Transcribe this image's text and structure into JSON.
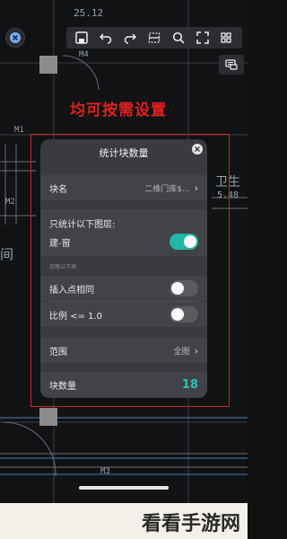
{
  "cad": {
    "dim_top": "25.12",
    "label_m4": "M4",
    "label_m1": "M1",
    "label_m2": "M2",
    "label_m3": "M3",
    "room_label": "卫生",
    "room_dim": "5.48",
    "left_char": "间"
  },
  "toolbar": {
    "icons": [
      "save-icon",
      "undo-icon",
      "redo-icon",
      "select-icon",
      "zoom-icon",
      "fullscreen-icon",
      "more-icon"
    ]
  },
  "annotation": "均可按需设置",
  "dialog": {
    "title": "统计块数量",
    "block_name_label": "块名",
    "block_name_value": "二维门库$...",
    "layer_only_label": "只统计以下图层:",
    "layer_name": "建-窗",
    "layer_toggle": true,
    "ignore_section": "忽略以下项",
    "insert_point_label": "插入点相同",
    "insert_point_toggle": false,
    "scale_label": "比例 <= 1.0",
    "scale_toggle": false,
    "range_label": "范围",
    "range_value": "全图",
    "count_label": "块数量",
    "count_value": "18"
  },
  "watermark": "看看手游网"
}
